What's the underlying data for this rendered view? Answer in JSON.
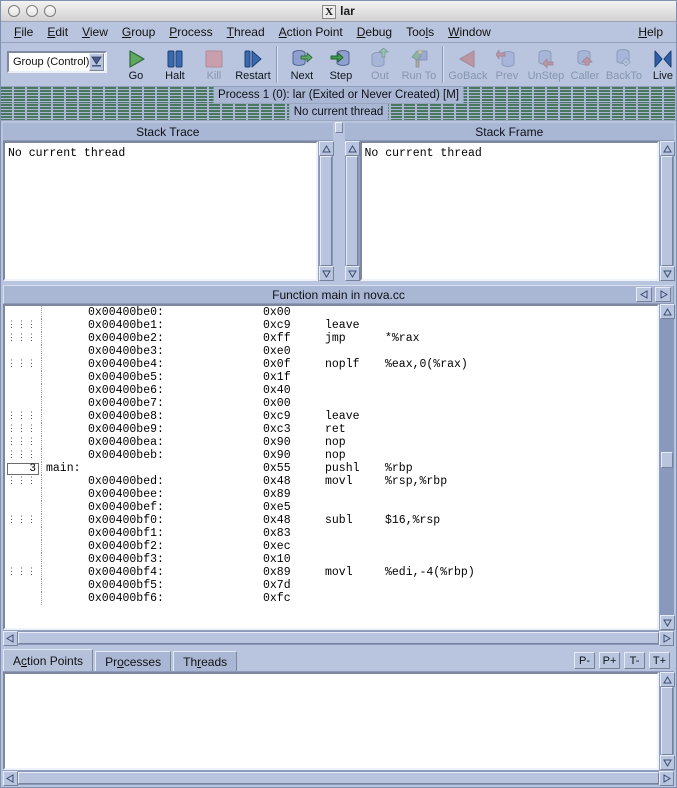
{
  "window": {
    "title": "lar",
    "title_icon": "X",
    "buttons": [
      "close",
      "minimize",
      "zoom"
    ]
  },
  "menubar": {
    "items": [
      {
        "label": "File",
        "mnemonic": "F"
      },
      {
        "label": "Edit",
        "mnemonic": "E"
      },
      {
        "label": "View",
        "mnemonic": "V"
      },
      {
        "label": "Group",
        "mnemonic": "G"
      },
      {
        "label": "Process",
        "mnemonic": "P"
      },
      {
        "label": "Thread",
        "mnemonic": "T"
      },
      {
        "label": "Action Point",
        "mnemonic": "A"
      },
      {
        "label": "Debug",
        "mnemonic": "D"
      },
      {
        "label": "Tools",
        "mnemonic": "l"
      },
      {
        "label": "Window",
        "mnemonic": "W"
      }
    ],
    "help": {
      "label": "Help",
      "mnemonic": "H"
    }
  },
  "toolbar": {
    "scope_selector": {
      "value": "Group (Control)",
      "icon": "chevron-down-icon"
    },
    "groups": [
      {
        "buttons": [
          {
            "label": "Go",
            "icon": "play-icon",
            "enabled": true
          },
          {
            "label": "Halt",
            "icon": "pause-icon",
            "enabled": true
          },
          {
            "label": "Kill",
            "icon": "stop-icon",
            "enabled": false
          },
          {
            "label": "Restart",
            "icon": "restart-icon",
            "enabled": true
          }
        ]
      },
      {
        "buttons": [
          {
            "label": "Next",
            "icon": "step-over-icon",
            "enabled": true
          },
          {
            "label": "Step",
            "icon": "step-into-icon",
            "enabled": true
          },
          {
            "label": "Out",
            "icon": "step-out-icon",
            "enabled": false
          },
          {
            "label": "Run To",
            "icon": "run-to-icon",
            "enabled": false
          }
        ]
      },
      {
        "buttons": [
          {
            "label": "GoBack",
            "icon": "go-back-icon",
            "enabled": false
          },
          {
            "label": "Prev",
            "icon": "prev-icon",
            "enabled": false
          },
          {
            "label": "UnStep",
            "icon": "unstep-icon",
            "enabled": false
          },
          {
            "label": "Caller",
            "icon": "caller-icon",
            "enabled": false
          },
          {
            "label": "BackTo",
            "icon": "back-to-icon",
            "enabled": false
          },
          {
            "label": "Live",
            "icon": "live-icon",
            "enabled": true
          }
        ]
      }
    ]
  },
  "status": {
    "process_line": "Process 1 (0): lar (Exited or Never Created) [M]",
    "thread_line": "No current thread"
  },
  "stack_trace": {
    "title": "Stack Trace",
    "content": "No current thread"
  },
  "stack_frame": {
    "title": "Stack Frame",
    "content": "No current thread"
  },
  "source": {
    "title": "Function main in nova.cc",
    "nav": {
      "back_icon": "triangle-left-icon",
      "forward_icon": "triangle-right-icon"
    },
    "rows": [
      {
        "marker": "",
        "lineno": "",
        "label": "",
        "addr": "0x00400be0:",
        "byte": "0x00",
        "op": "",
        "args": ""
      },
      {
        "marker": "dots",
        "lineno": "",
        "label": "",
        "addr": "0x00400be1:",
        "byte": "0xc9",
        "op": "leave",
        "args": ""
      },
      {
        "marker": "dots",
        "lineno": "",
        "label": "",
        "addr": "0x00400be2:",
        "byte": "0xff",
        "op": "jmp",
        "args": "*%rax"
      },
      {
        "marker": "",
        "lineno": "",
        "label": "",
        "addr": "0x00400be3:",
        "byte": "0xe0",
        "op": "",
        "args": ""
      },
      {
        "marker": "dots",
        "lineno": "",
        "label": "",
        "addr": "0x00400be4:",
        "byte": "0x0f",
        "op": "noplf",
        "args": "%eax,0(%rax)"
      },
      {
        "marker": "",
        "lineno": "",
        "label": "",
        "addr": "0x00400be5:",
        "byte": "0x1f",
        "op": "",
        "args": ""
      },
      {
        "marker": "",
        "lineno": "",
        "label": "",
        "addr": "0x00400be6:",
        "byte": "0x40",
        "op": "",
        "args": ""
      },
      {
        "marker": "",
        "lineno": "",
        "label": "",
        "addr": "0x00400be7:",
        "byte": "0x00",
        "op": "",
        "args": ""
      },
      {
        "marker": "dots",
        "lineno": "",
        "label": "",
        "addr": "0x00400be8:",
        "byte": "0xc9",
        "op": "leave",
        "args": ""
      },
      {
        "marker": "dots",
        "lineno": "",
        "label": "",
        "addr": "0x00400be9:",
        "byte": "0xc3",
        "op": "ret",
        "args": ""
      },
      {
        "marker": "dots",
        "lineno": "",
        "label": "",
        "addr": "0x00400bea:",
        "byte": "0x90",
        "op": "nop",
        "args": ""
      },
      {
        "marker": "dots",
        "lineno": "",
        "label": "",
        "addr": "0x00400beb:",
        "byte": "0x90",
        "op": "nop",
        "args": ""
      },
      {
        "marker": "",
        "lineno": "3",
        "label": "main:",
        "addr": "",
        "byte": "0x55",
        "op": "pushl",
        "args": "%rbp"
      },
      {
        "marker": "dots",
        "lineno": "",
        "label": "",
        "addr": "0x00400bed:",
        "byte": "0x48",
        "op": "movl",
        "args": "%rsp,%rbp"
      },
      {
        "marker": "",
        "lineno": "",
        "label": "",
        "addr": "0x00400bee:",
        "byte": "0x89",
        "op": "",
        "args": ""
      },
      {
        "marker": "",
        "lineno": "",
        "label": "",
        "addr": "0x00400bef:",
        "byte": "0xe5",
        "op": "",
        "args": ""
      },
      {
        "marker": "dots",
        "lineno": "",
        "label": "",
        "addr": "0x00400bf0:",
        "byte": "0x48",
        "op": "subl",
        "args": "$16,%rsp"
      },
      {
        "marker": "",
        "lineno": "",
        "label": "",
        "addr": "0x00400bf1:",
        "byte": "0x83",
        "op": "",
        "args": ""
      },
      {
        "marker": "",
        "lineno": "",
        "label": "",
        "addr": "0x00400bf2:",
        "byte": "0xec",
        "op": "",
        "args": ""
      },
      {
        "marker": "",
        "lineno": "",
        "label": "",
        "addr": "0x00400bf3:",
        "byte": "0x10",
        "op": "",
        "args": ""
      },
      {
        "marker": "dots",
        "lineno": "",
        "label": "",
        "addr": "0x00400bf4:",
        "byte": "0x89",
        "op": "movl",
        "args": "%edi,-4(%rbp)"
      },
      {
        "marker": "",
        "lineno": "",
        "label": "",
        "addr": "0x00400bf5:",
        "byte": "0x7d",
        "op": "",
        "args": ""
      },
      {
        "marker": "",
        "lineno": "",
        "label": "",
        "addr": "0x00400bf6:",
        "byte": "0xfc",
        "op": "",
        "args": ""
      }
    ]
  },
  "bottom": {
    "tabs": [
      {
        "label": "Action Points",
        "mnemonic": "c",
        "selected": true
      },
      {
        "label": "Processes",
        "mnemonic": "o",
        "selected": false
      },
      {
        "label": "Threads",
        "mnemonic": "r",
        "selected": false
      }
    ],
    "buttons": [
      {
        "label": "P-"
      },
      {
        "label": "P+"
      },
      {
        "label": "T-"
      },
      {
        "label": "T+"
      }
    ],
    "content": ""
  },
  "colors": {
    "chrome": "#b9c5de",
    "panel_header": "#aab7d4",
    "status_stripe_green": "#49785f",
    "titlebar": "#e8e8e8",
    "text": "#0d1017"
  }
}
